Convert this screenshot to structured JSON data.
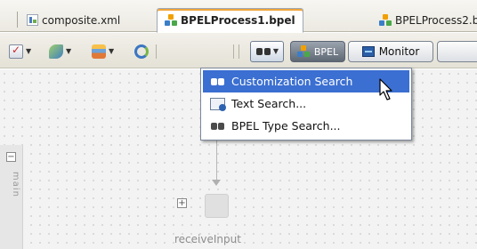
{
  "tabs": [
    {
      "label": "composite.xml",
      "icon": "composite-xml-icon",
      "active": false
    },
    {
      "label": "BPELProcess1.bpel",
      "icon": "bpel-process-icon",
      "active": true
    },
    {
      "label": "BPELProcess2.bpe",
      "icon": "bpel-process-icon",
      "active": false
    }
  ],
  "toolbar": {
    "bpel_label": "BPEL",
    "monitor_label": "Monitor"
  },
  "search_menu": {
    "items": [
      {
        "label": "Customization Search",
        "icon": "binoculars-icon",
        "selected": true
      },
      {
        "label": "Text Search...",
        "icon": "text-search-icon",
        "selected": false
      },
      {
        "label": "BPEL Type Search...",
        "icon": "binoculars-icon",
        "selected": false
      }
    ]
  },
  "canvas": {
    "swimlane_label": "main",
    "activity_label": "receiveInput"
  },
  "colors": {
    "selection": "#3b6fd1",
    "canvas_background": "#f3f3f3",
    "tab_accent": "#f0a53a"
  }
}
